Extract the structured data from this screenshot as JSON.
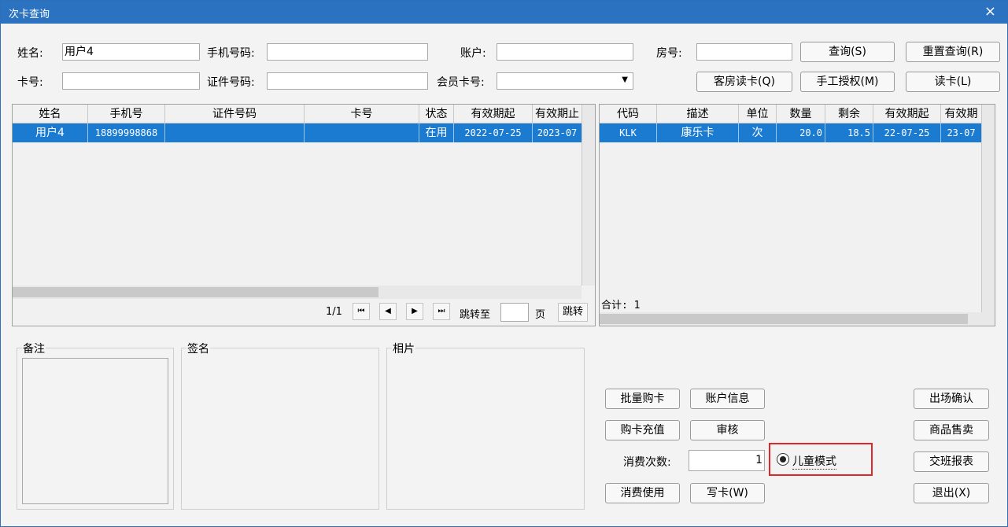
{
  "window": {
    "title": "次卡查询",
    "close": "×"
  },
  "search": {
    "name_label": "姓名:",
    "name_value": "用户4",
    "phone_label": "手机号码:",
    "phone_value": "",
    "account_label": "账户:",
    "account_value": "",
    "room_label": "房号:",
    "room_value": "",
    "card_label": "卡号:",
    "card_value": "",
    "id_label": "证件号码:",
    "id_value": "",
    "member_label": "会员卡号:",
    "member_value": ""
  },
  "buttons": {
    "query": "查询(S)",
    "reset": "重置查询(R)",
    "guest_read": "客房读卡(Q)",
    "manual_auth": "手工授权(M)",
    "read_card": "读卡(L)",
    "batch_buy": "批量购卡",
    "account_info": "账户信息",
    "checkout_confirm": "出场确认",
    "buy_recharge": "购卡充值",
    "audit": "审核",
    "goods_sale": "商品售卖",
    "consume_use": "消费使用",
    "write_card": "写卡(W)",
    "shift_report": "交班报表",
    "exit": "退出(X)"
  },
  "left_table": {
    "headers": [
      "姓名",
      "手机号",
      "证件号码",
      "卡号",
      "状态",
      "有效期起",
      "有效期止"
    ],
    "rows": [
      [
        "用户4",
        "18899998868",
        "",
        "",
        "在用",
        "2022-07-25",
        "2023-07"
      ]
    ]
  },
  "pager": {
    "page": "1/1",
    "first": "⏮",
    "prev": "◀",
    "next": "▶",
    "last": "⏭",
    "goto_label": "跳转至",
    "page_unit": "页",
    "goto_btn": "跳转"
  },
  "right_table": {
    "headers": [
      "代码",
      "描述",
      "单位",
      "数量",
      "剩余",
      "有效期起",
      "有效期"
    ],
    "rows": [
      [
        "KLK",
        "康乐卡",
        "次",
        "20.0",
        "18.5",
        "22-07-25",
        "23-07"
      ]
    ],
    "total": "合计: 1"
  },
  "groups": {
    "remark": "备注",
    "signature": "签名",
    "photo": "相片"
  },
  "consume": {
    "label": "消费次数:",
    "value": "1",
    "child_mode": "儿童模式"
  }
}
